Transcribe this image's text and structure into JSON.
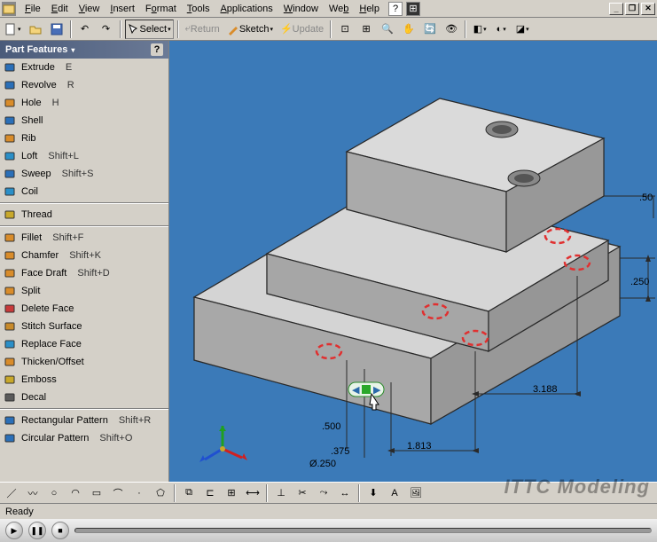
{
  "menu": {
    "items": [
      "File",
      "Edit",
      "View",
      "Insert",
      "Format",
      "Tools",
      "Applications",
      "Window",
      "Web",
      "Help"
    ]
  },
  "window_controls": {
    "min": "_",
    "restore": "❐",
    "close": "✕"
  },
  "toolbar": {
    "select": "Select",
    "return": "Return",
    "sketch": "Sketch",
    "update": "Update"
  },
  "panel": {
    "title": "Part Features",
    "items": [
      {
        "icon": "extrude-icon",
        "label": "Extrude",
        "shortcut": "E",
        "color": "#2a6fb8"
      },
      {
        "icon": "revolve-icon",
        "label": "Revolve",
        "shortcut": "R",
        "color": "#2a6fb8"
      },
      {
        "icon": "hole-icon",
        "label": "Hole",
        "shortcut": "H",
        "color": "#d98c2a"
      },
      {
        "icon": "shell-icon",
        "label": "Shell",
        "shortcut": "",
        "color": "#2a6fb8"
      },
      {
        "icon": "rib-icon",
        "label": "Rib",
        "shortcut": "",
        "color": "#d98c2a"
      },
      {
        "icon": "loft-icon",
        "label": "Loft",
        "shortcut": "Shift+L",
        "color": "#2a8fc8"
      },
      {
        "icon": "sweep-icon",
        "label": "Sweep",
        "shortcut": "Shift+S",
        "color": "#2a6fb8"
      },
      {
        "icon": "coil-icon",
        "label": "Coil",
        "shortcut": "",
        "color": "#2a8fc8"
      }
    ],
    "items2": [
      {
        "icon": "thread-icon",
        "label": "Thread",
        "shortcut": "",
        "color": "#c8a82a"
      }
    ],
    "items3": [
      {
        "icon": "fillet-icon",
        "label": "Fillet",
        "shortcut": "Shift+F",
        "color": "#d98c2a"
      },
      {
        "icon": "chamfer-icon",
        "label": "Chamfer",
        "shortcut": "Shift+K",
        "color": "#d98c2a"
      },
      {
        "icon": "facedraft-icon",
        "label": "Face Draft",
        "shortcut": "Shift+D",
        "color": "#d98c2a"
      },
      {
        "icon": "split-icon",
        "label": "Split",
        "shortcut": "",
        "color": "#d98c2a"
      },
      {
        "icon": "deleteface-icon",
        "label": "Delete Face",
        "shortcut": "",
        "color": "#c83a3a"
      },
      {
        "icon": "stitch-icon",
        "label": "Stitch Surface",
        "shortcut": "",
        "color": "#c88a2a"
      },
      {
        "icon": "replaceface-icon",
        "label": "Replace Face",
        "shortcut": "",
        "color": "#2a8fc8"
      },
      {
        "icon": "thicken-icon",
        "label": "Thicken/Offset",
        "shortcut": "",
        "color": "#d98c2a"
      },
      {
        "icon": "emboss-icon",
        "label": "Emboss",
        "shortcut": "",
        "color": "#c8a82a"
      },
      {
        "icon": "decal-icon",
        "label": "Decal",
        "shortcut": "",
        "color": "#5a5a5a"
      }
    ],
    "items4": [
      {
        "icon": "rectpattern-icon",
        "label": "Rectangular Pattern",
        "shortcut": "Shift+R",
        "color": "#2a6fb8"
      },
      {
        "icon": "circpattern-icon",
        "label": "Circular Pattern",
        "shortcut": "Shift+O",
        "color": "#2a6fb8"
      }
    ]
  },
  "dimensions": {
    "d1": ".500",
    "d2": ".375",
    "d3": "Ø.250",
    "d4": "1.813",
    "d5": "3.188",
    "d6": ".250",
    "d7": ".50"
  },
  "status": {
    "text": "Ready"
  },
  "watermark": "ITTC Modeling",
  "colors": {
    "viewport_bg": "#3b7ab8",
    "part_fill": "#c8c8c8",
    "part_edge": "#2a2a2a",
    "dim_red": "#e03030",
    "axis_x": "#d02020",
    "axis_y": "#20a020",
    "axis_z": "#2050d0"
  }
}
